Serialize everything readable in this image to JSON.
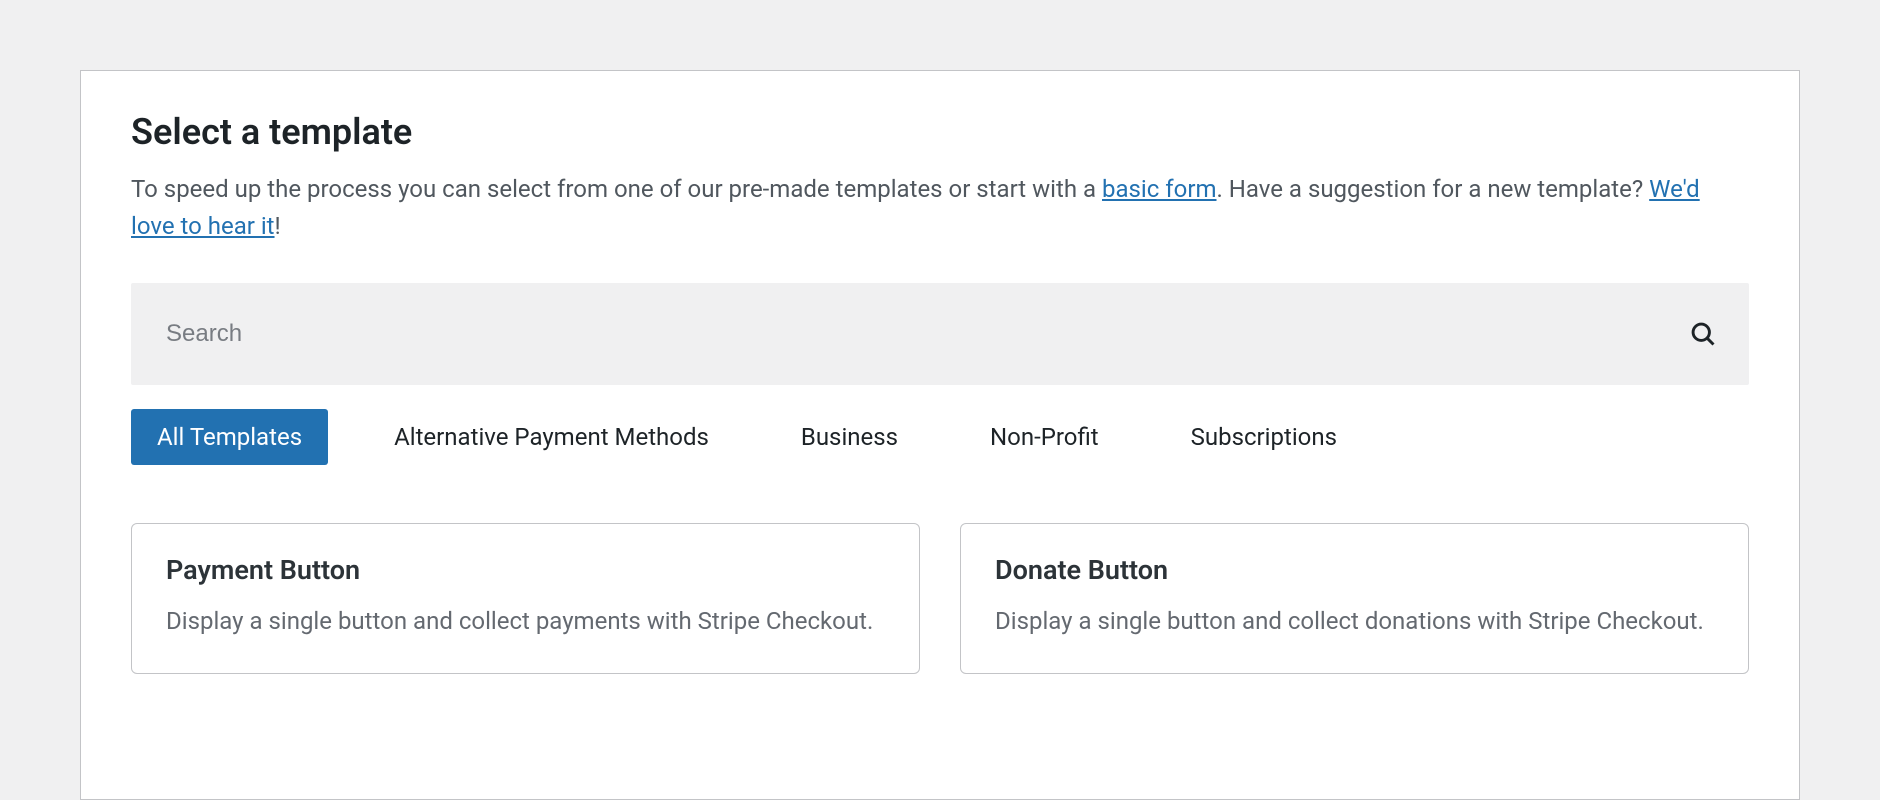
{
  "header": {
    "title": "Select a template",
    "subtitle_pre": "To speed up the process you can select from one of our pre-made templates or start with a ",
    "subtitle_link1": "basic form",
    "subtitle_mid": ". Have a suggestion for a new template? ",
    "subtitle_link2": "We'd love to hear it",
    "subtitle_post": "!"
  },
  "search": {
    "placeholder": "Search",
    "value": ""
  },
  "tabs": [
    {
      "label": "All Templates",
      "active": true
    },
    {
      "label": "Alternative Payment Methods",
      "active": false
    },
    {
      "label": "Business",
      "active": false
    },
    {
      "label": "Non-Profit",
      "active": false
    },
    {
      "label": "Subscriptions",
      "active": false
    }
  ],
  "cards": [
    {
      "title": "Payment Button",
      "desc": "Display a single button and collect payments with Stripe Checkout."
    },
    {
      "title": "Donate Button",
      "desc": "Display a single button and collect donations with Stripe Checkout."
    }
  ]
}
